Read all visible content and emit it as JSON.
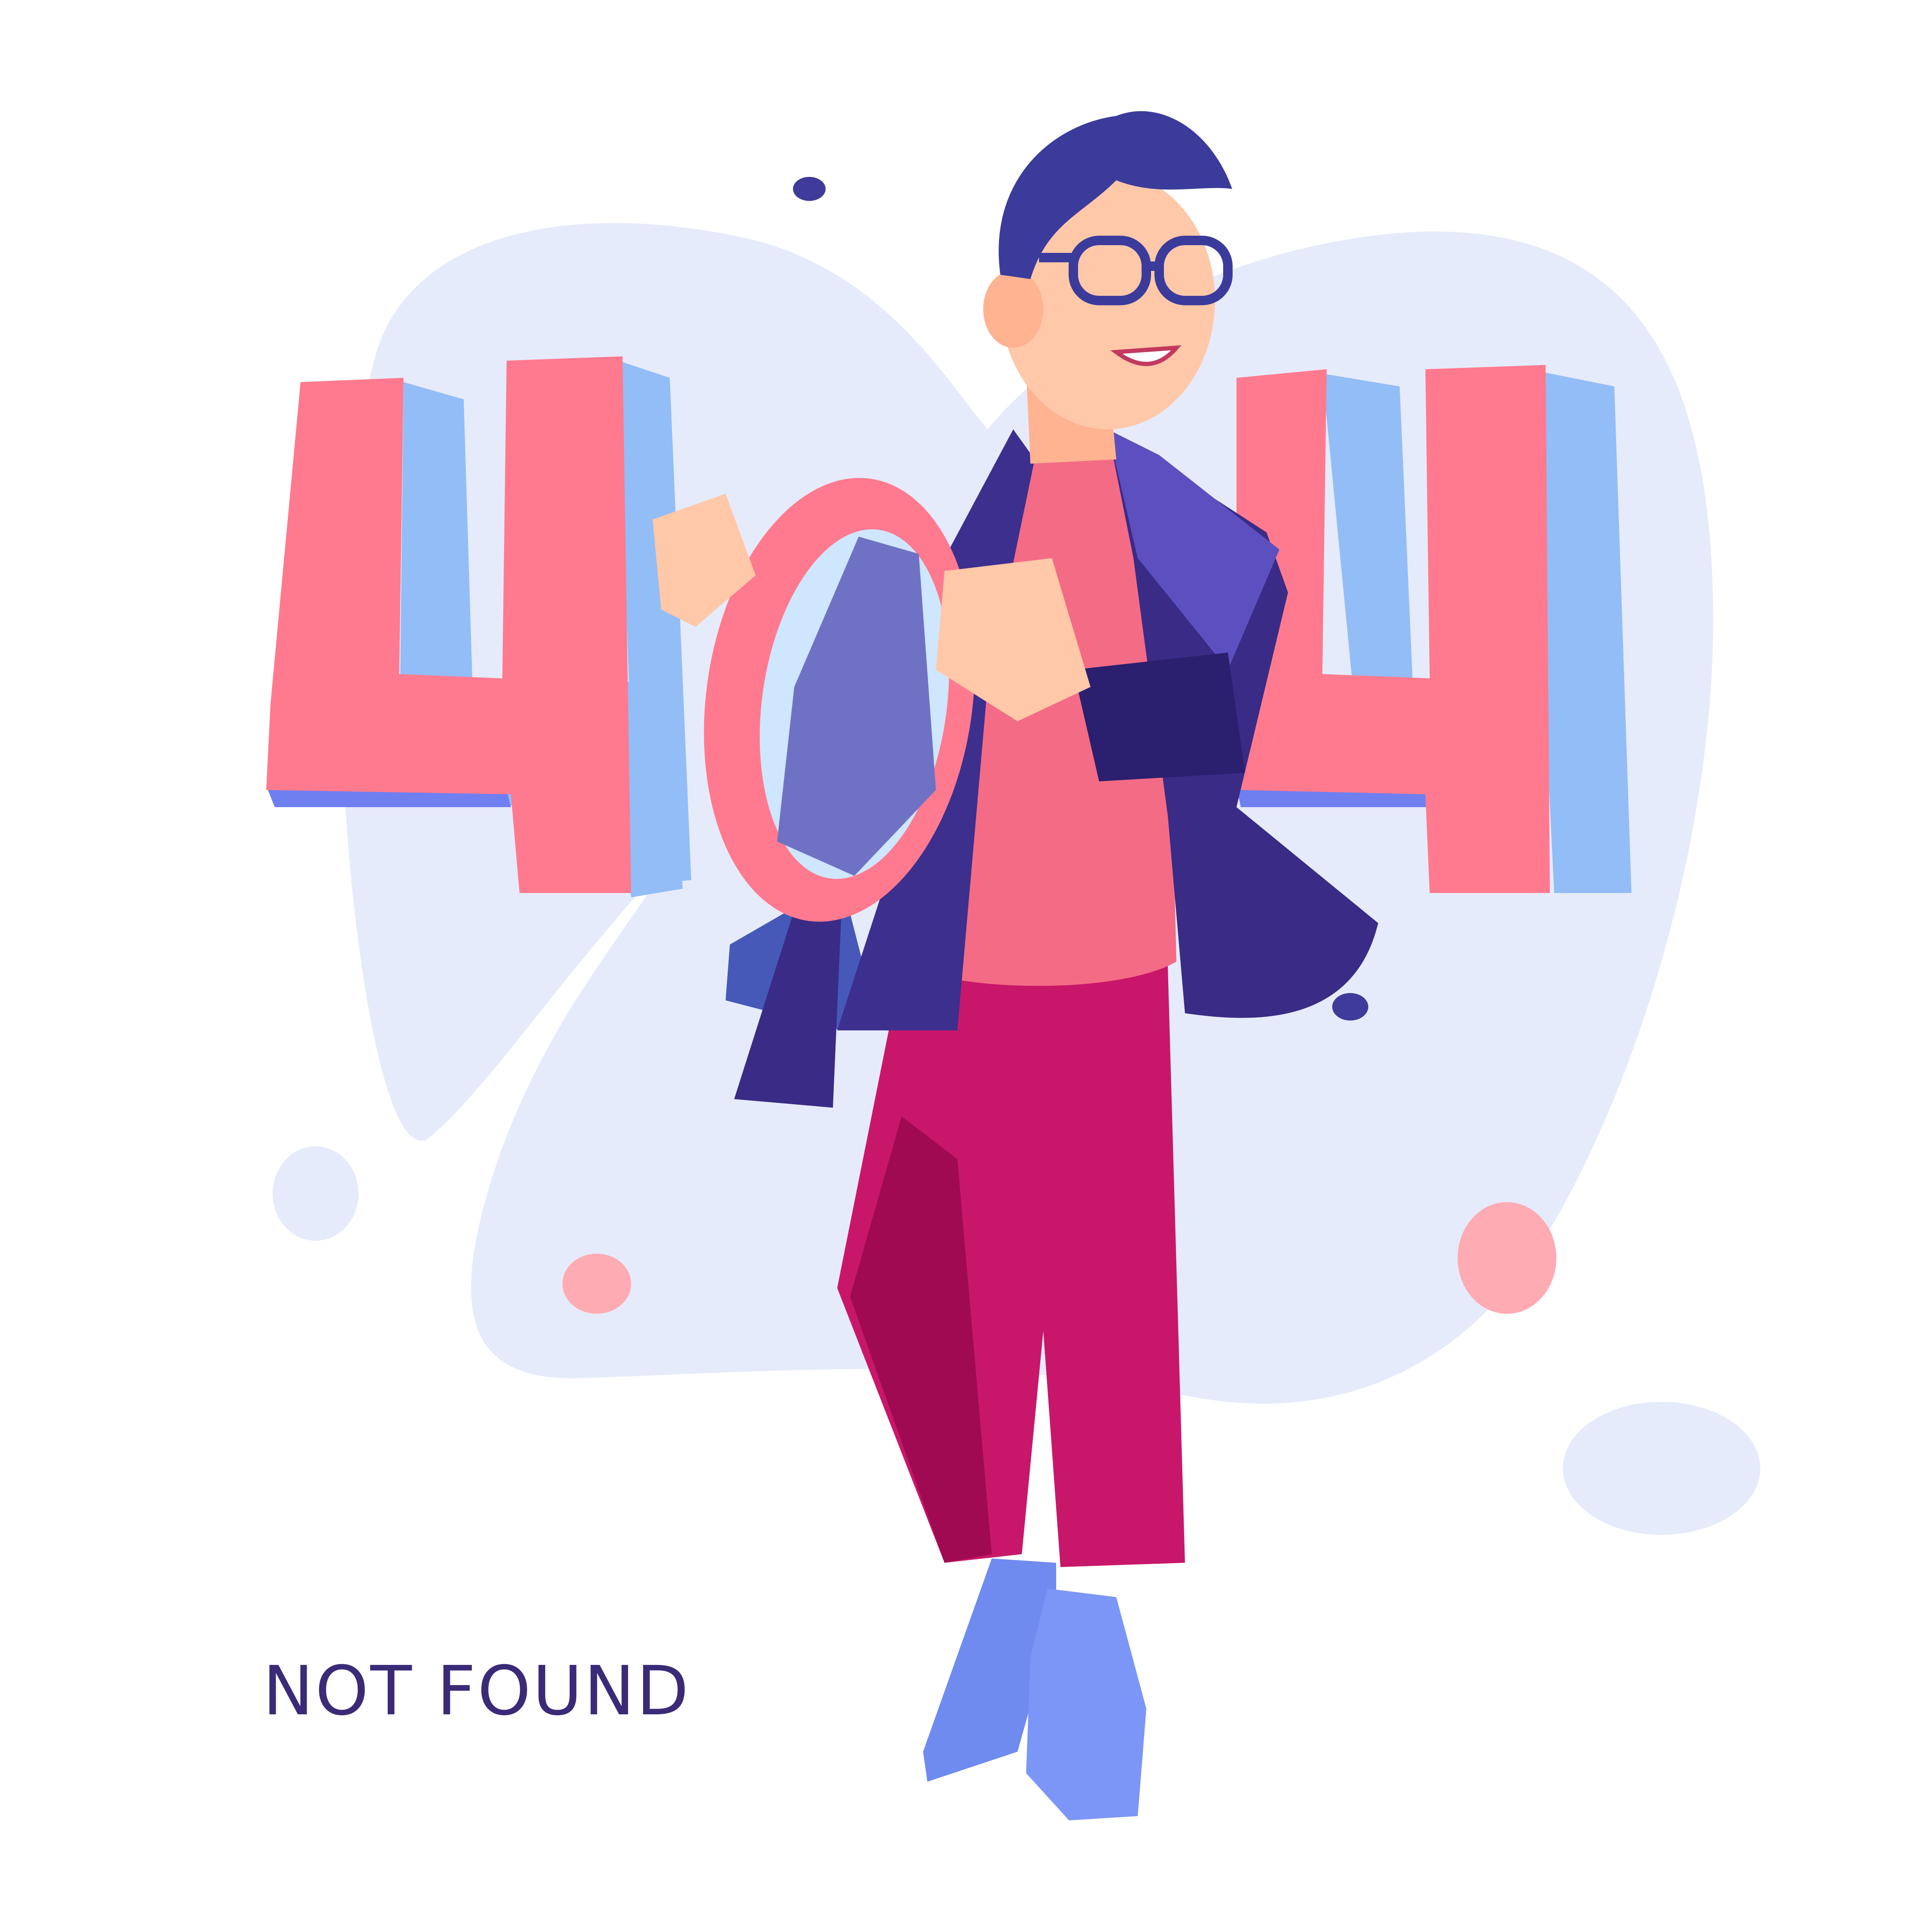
{
  "code": {
    "digit_1": "4",
    "digit_2": "0",
    "digit_3": "4"
  },
  "caption": "NOT FOUND",
  "colors": {
    "digit_face": "#ff7a8e",
    "digit_side": "#92bdf7",
    "blob": "#e6ebfb",
    "jacket": "#3d2f8e",
    "shirt": "#f46b85",
    "pants": "#c8176a",
    "shoes": "#6f8bf0",
    "hair": "#3b3b9c",
    "caption_text": "#3b2a78"
  },
  "icons": [
    "magnifying-glass-icon"
  ]
}
